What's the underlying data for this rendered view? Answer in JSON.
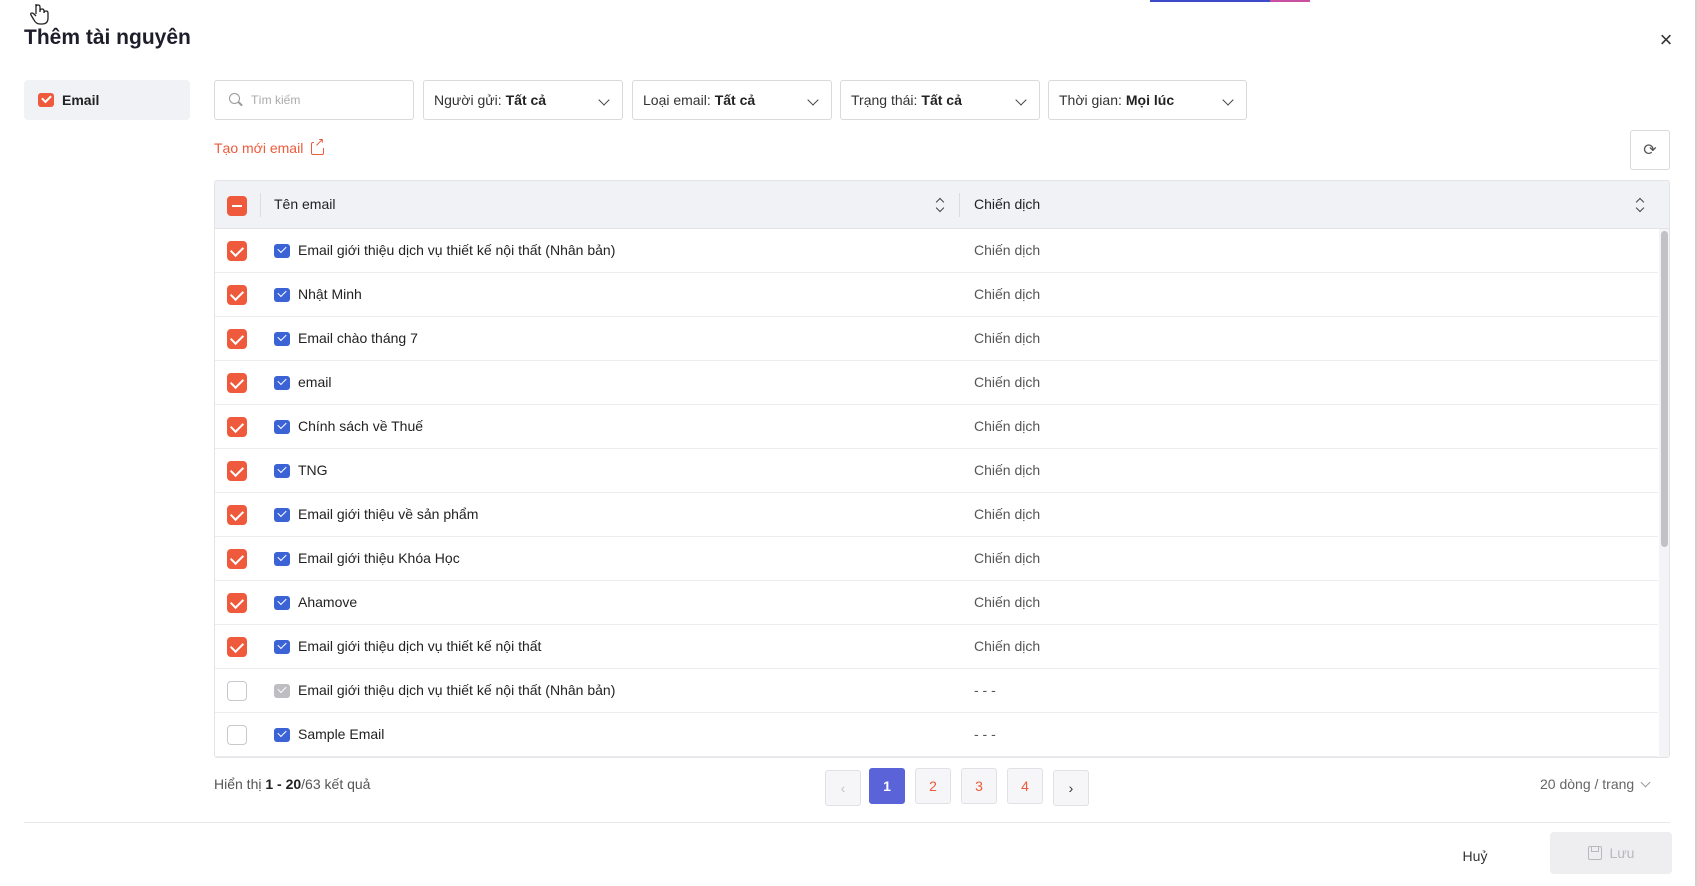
{
  "dialog": {
    "title": "Thêm tài nguyên",
    "close_symbol": "×"
  },
  "sidebar": {
    "items": [
      {
        "label": "Email",
        "icon": "mail-icon",
        "selected": true
      }
    ]
  },
  "filters": {
    "search_placeholder": "Tìm kiếm",
    "sender": {
      "label": "Người gửi:",
      "value": "Tất cả"
    },
    "email_type": {
      "label": "Loại email:",
      "value": "Tất cả"
    },
    "status": {
      "label": "Trạng thái:",
      "value": "Tất cả"
    },
    "time": {
      "label": "Thời gian:",
      "value": "Mọi lúc"
    }
  },
  "create_link": "Tạo mới email",
  "refresh_symbol": "⟳",
  "table": {
    "columns": [
      "Tên email",
      "Chiến dịch"
    ],
    "rows": [
      {
        "checked": true,
        "icon": "blue",
        "name": "Email giới thiệu dịch vụ thiết kế nội thất (Nhân bản)",
        "campaign": "Chiến dịch"
      },
      {
        "checked": true,
        "icon": "blue",
        "name": "Nhật Minh",
        "campaign": "Chiến dịch"
      },
      {
        "checked": true,
        "icon": "blue",
        "name": "Email chào tháng 7",
        "campaign": "Chiến dịch"
      },
      {
        "checked": true,
        "icon": "blue",
        "name": "email",
        "campaign": "Chiến dịch"
      },
      {
        "checked": true,
        "icon": "blue",
        "name": "Chính sách về Thuế",
        "campaign": "Chiến dịch"
      },
      {
        "checked": true,
        "icon": "blue",
        "name": "TNG",
        "campaign": "Chiến dịch"
      },
      {
        "checked": true,
        "icon": "blue",
        "name": "Email giới thiệu về sản phẩm",
        "campaign": "Chiến dịch"
      },
      {
        "checked": true,
        "icon": "blue",
        "name": "Email giới thiệu Khóa Học",
        "campaign": "Chiến dịch"
      },
      {
        "checked": true,
        "icon": "blue",
        "name": "Ahamove",
        "campaign": "Chiến dịch"
      },
      {
        "checked": true,
        "icon": "blue",
        "name": "Email giới thiệu dịch vụ thiết kế nội thất",
        "campaign": "Chiến dịch"
      },
      {
        "checked": false,
        "icon": "gray",
        "name": "Email giới thiệu dịch vụ thiết kế nội thất (Nhân bản)",
        "campaign": "- - -"
      },
      {
        "checked": false,
        "icon": "blue",
        "name": "Sample Email",
        "campaign": "- - -"
      }
    ]
  },
  "pagination": {
    "summary_prefix": "Hiển thị",
    "range": "1 - 20",
    "total": "/63",
    "summary_suffix": "kết quả",
    "prev_symbol": "‹",
    "next_symbol": "›",
    "pages": [
      "1",
      "2",
      "3",
      "4"
    ],
    "current_page": "1",
    "per_page": "20 dòng / trang"
  },
  "actions": {
    "cancel": "Huỷ",
    "save": "Lưu"
  },
  "colors": {
    "accent": "#ee5a3b",
    "primary": "#5b63d8",
    "email_icon": "#3b63d6"
  }
}
